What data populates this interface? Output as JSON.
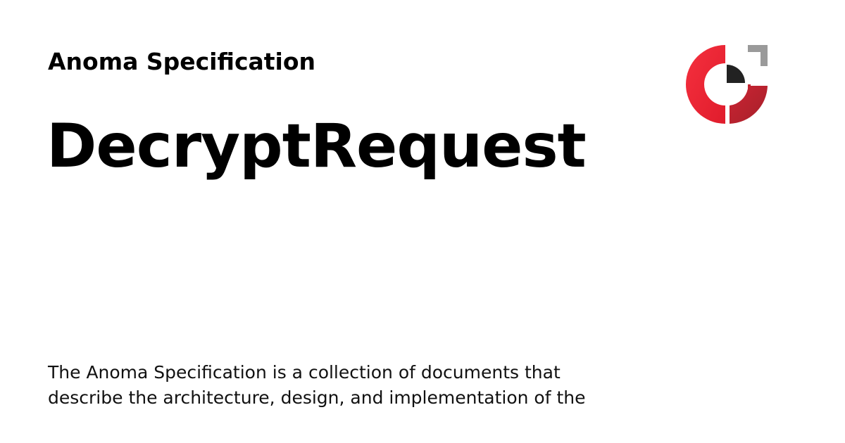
{
  "header": {
    "site_name": "Anoma Specification"
  },
  "main": {
    "title": "DecryptRequest",
    "description": "The Anoma Specification is a collection of documents that describe the architecture, design, and implementation of the"
  },
  "logo": {
    "icon": "anoma-logo-icon",
    "colors": {
      "red": "#ee2233",
      "dark_red": "#b8222e",
      "gray": "#9a9a9a",
      "black": "#222222"
    }
  }
}
